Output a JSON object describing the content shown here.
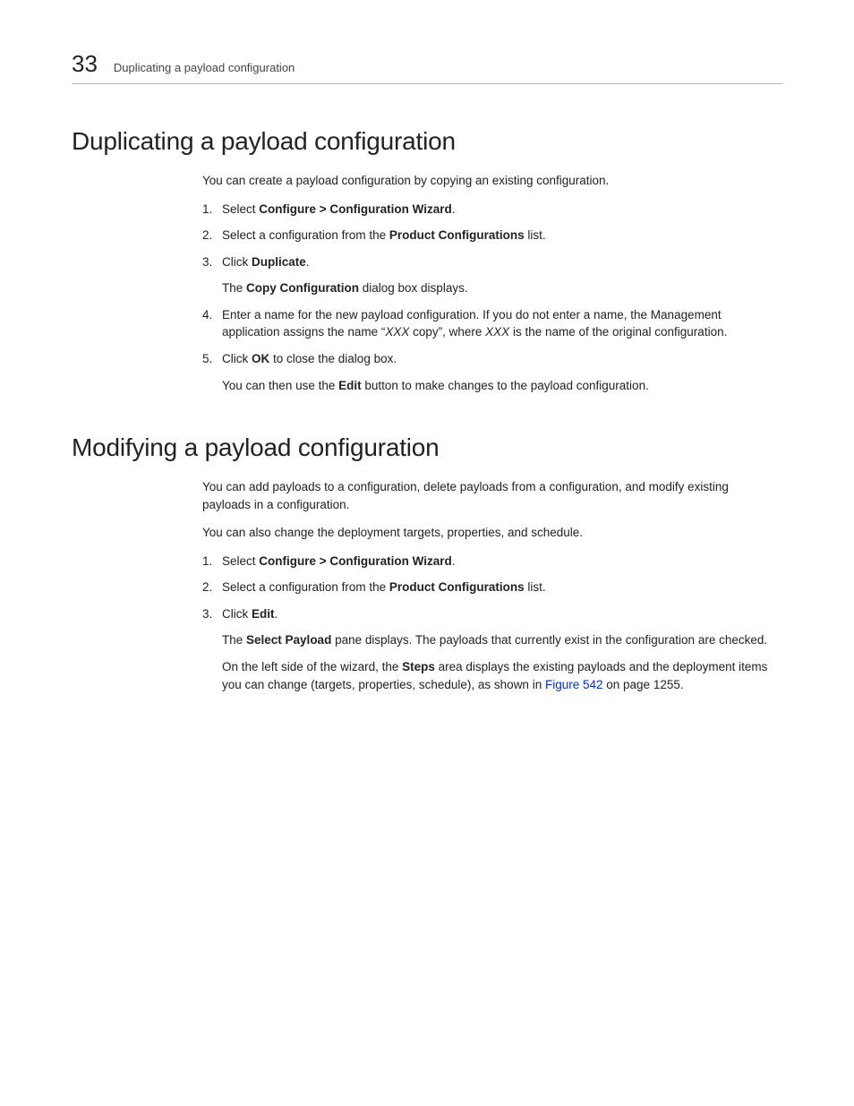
{
  "header": {
    "chapter_number": "33",
    "running_title": "Duplicating a payload configuration"
  },
  "section1": {
    "heading": "Duplicating a payload configuration",
    "intro": "You can create a payload configuration by copying an existing configuration.",
    "steps": {
      "s1": {
        "num": "1.",
        "pre": "Select ",
        "bold": "Configure > Configuration Wizard",
        "post": "."
      },
      "s2": {
        "num": "2.",
        "pre": "Select a configuration from the ",
        "bold": "Product Configurations",
        "post": " list."
      },
      "s3": {
        "num": "3.",
        "pre": "Click ",
        "bold": "Duplicate",
        "post": ".",
        "sub_pre": "The ",
        "sub_bold": "Copy Configuration",
        "sub_post": " dialog box displays."
      },
      "s4": {
        "num": "4.",
        "line_a": "Enter a name for the new payload configuration. If you do not enter a name, the Management application assigns the name “",
        "italic1": "XXX",
        "line_b": " copy”, where ",
        "italic2": "XXX",
        "line_c": " is the name of the original configuration."
      },
      "s5": {
        "num": "5.",
        "pre": "Click ",
        "bold": "OK",
        "post": " to close the dialog box.",
        "sub_pre": "You can then use the ",
        "sub_bold": "Edit",
        "sub_post": " button to make changes to the payload configuration."
      }
    }
  },
  "section2": {
    "heading": "Modifying a payload configuration",
    "intro1": "You can add payloads to a configuration, delete payloads from a configuration, and modify existing payloads in a configuration.",
    "intro2": "You can also change the deployment targets, properties, and schedule.",
    "steps": {
      "s1": {
        "num": "1.",
        "pre": "Select ",
        "bold": "Configure > Configuration Wizard",
        "post": "."
      },
      "s2": {
        "num": "2.",
        "pre": "Select a configuration from the ",
        "bold": "Product Configurations",
        "post": " list."
      },
      "s3": {
        "num": "3.",
        "pre": "Click ",
        "bold": "Edit",
        "post": ".",
        "sub1_pre": "The ",
        "sub1_bold": "Select Payload",
        "sub1_post": " pane displays. The payloads that currently exist in the configuration are checked.",
        "sub2_pre": "On the left side of the wizard, the ",
        "sub2_bold": "Steps",
        "sub2_mid": " area displays the existing payloads and the deployment items you can change (targets, properties, schedule), as shown in ",
        "sub2_link": "Figure 542",
        "sub2_post": " on page 1255."
      }
    }
  }
}
